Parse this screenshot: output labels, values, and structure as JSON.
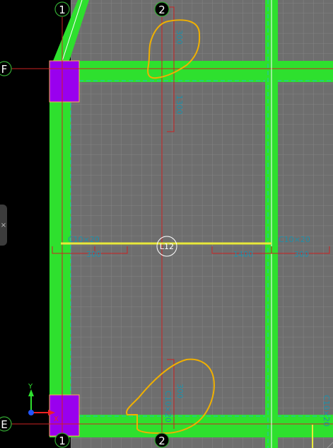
{
  "grid_axes": {
    "vertical": [
      {
        "id": "axis-1-top",
        "label": "1"
      },
      {
        "id": "axis-2-top",
        "label": "2"
      },
      {
        "id": "axis-1-bottom",
        "label": "1"
      },
      {
        "id": "axis-2-bottom",
        "label": "2"
      }
    ],
    "horizontal": [
      {
        "id": "axis-F",
        "label": "F"
      },
      {
        "id": "axis-E",
        "label": "E"
      }
    ]
  },
  "dimensions": {
    "left_beam_code": "C10×20",
    "left_beam_length": "300",
    "right_beam_code": "C10×20",
    "right_beam_length": "1400",
    "right_beam_length_2": "300",
    "top_vertical_a": "300",
    "top_vertical_b": "1300",
    "bottom_vertical_a": "300",
    "bottom_vertical_b": "C10×20",
    "edge_right_bottom": "C10×20"
  },
  "center_marker": {
    "label": "L12"
  },
  "ucs_icon": {
    "x_label": "X",
    "y_label": "Y"
  },
  "side_panel_toggle": {
    "glyph": "×"
  },
  "colors": {
    "background": "#000000",
    "slab": "#6e6e6e",
    "grid": "#8a8a8a",
    "beam": "#2ee02e",
    "beam_edge": "#20c0c0",
    "column": "#9900ee",
    "axis_line": "#cc2222",
    "cloud": "#f0b000",
    "highlight_beam": "#e8e83a",
    "dimension_text": "#1f8fa8"
  }
}
